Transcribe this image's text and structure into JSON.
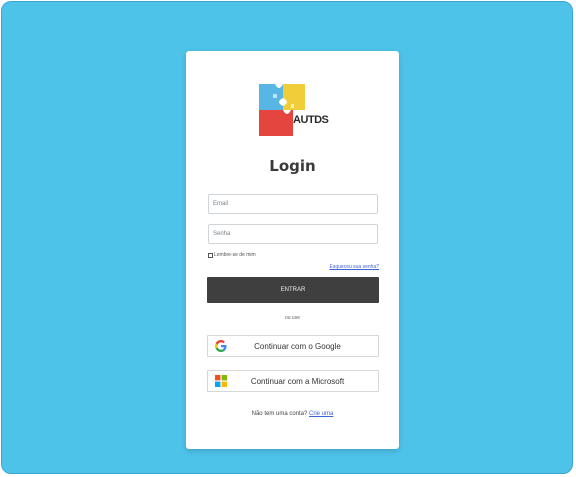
{
  "app": {
    "logo_text": "AUTDS"
  },
  "login": {
    "title": "Login",
    "email_placeholder": "Email",
    "password_placeholder": "Senha",
    "remember_label": "Lembre-se de mim",
    "forgot_link": "Esqueceu sua senha?",
    "enter_button": "ENTRAR",
    "or_text": "ou use",
    "google_button": "Continuar com o Google",
    "microsoft_button": "Continuar com a Microsoft",
    "signup_prompt": "Não tem uma conta?",
    "signup_link": "Crie uma"
  },
  "colors": {
    "background": "#4ec3ea",
    "card": "#ffffff",
    "primary_button": "#3f3f3f",
    "link": "#3d63d8"
  },
  "icons": {
    "google": "google-icon",
    "microsoft": "microsoft-icon",
    "logo": "puzzle-logo-icon"
  }
}
